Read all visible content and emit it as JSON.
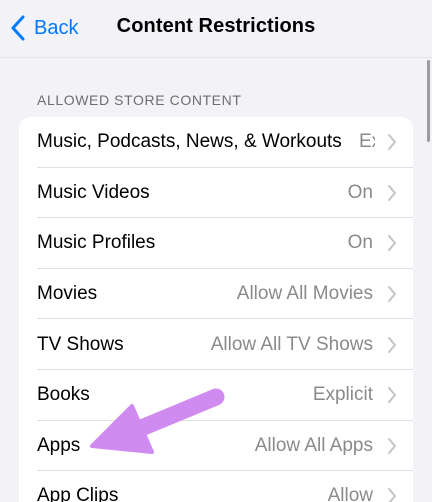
{
  "nav": {
    "back_label": "Back",
    "title": "Content Restrictions"
  },
  "section": {
    "header": "ALLOWED STORE CONTENT"
  },
  "rows": [
    {
      "label": "Music, Podcasts, News, & Workouts",
      "value": "Explicit"
    },
    {
      "label": "Music Videos",
      "value": "On"
    },
    {
      "label": "Music Profiles",
      "value": "On"
    },
    {
      "label": "Movies",
      "value": "Allow All Movies"
    },
    {
      "label": "TV Shows",
      "value": "Allow All TV Shows"
    },
    {
      "label": "Books",
      "value": "Explicit"
    },
    {
      "label": "Apps",
      "value": "Allow All Apps"
    },
    {
      "label": "App Clips",
      "value": "Allow"
    }
  ],
  "colors": {
    "accent": "#007aff",
    "annotation_arrow": "#cf8bf0",
    "secondary_text": "#8a8a8e",
    "background": "#f2f2f7"
  },
  "icons": {
    "back": "chevron-left-icon",
    "row": "chevron-right-icon"
  }
}
